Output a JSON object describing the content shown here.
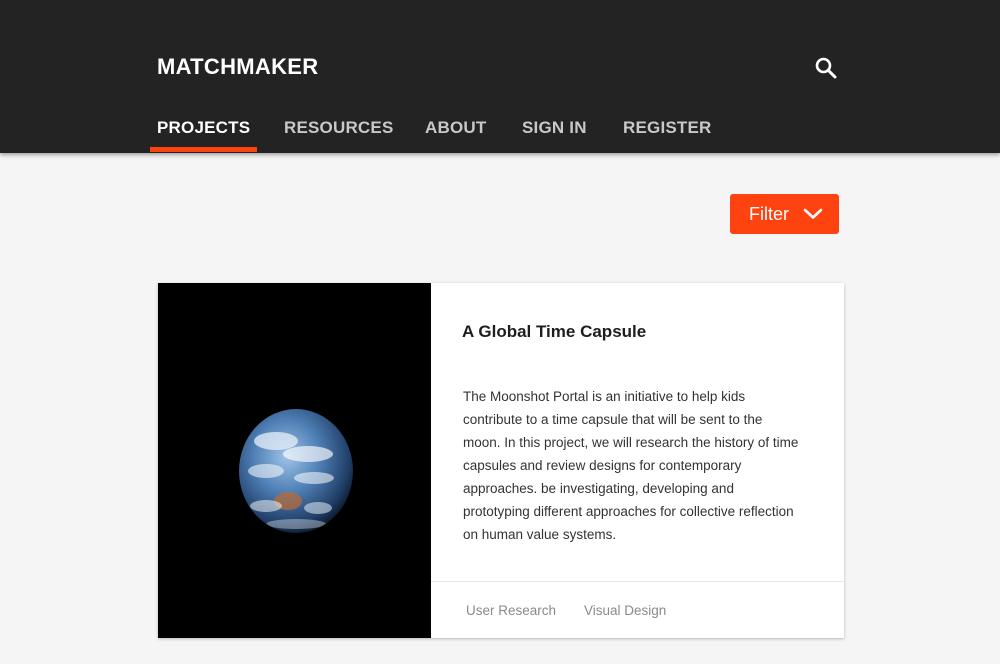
{
  "header": {
    "brand": "MATCHMAKER",
    "search_icon": "search-icon"
  },
  "nav": {
    "items": [
      {
        "label": "PROJECTS",
        "active": true
      },
      {
        "label": "RESOURCES",
        "active": false
      },
      {
        "label": "ABOUT",
        "active": false
      },
      {
        "label": "SIGN IN",
        "active": false
      },
      {
        "label": "REGISTER",
        "active": false
      }
    ]
  },
  "filter": {
    "label": "Filter",
    "icon": "chevron-down-icon"
  },
  "card": {
    "title": "A Global Time Capsule",
    "description": "The Moonshot Portal is an initiative to help kids contribute to a time capsule that will be sent to the moon. In this project, we will research the history of time capsules and review designs for contemporary approaches. be investigating, developing and prototyping different approaches for collective reflection on human value systems.",
    "image": "earth-image",
    "tags": [
      "User Research",
      "Visual Design"
    ]
  },
  "colors": {
    "header_bg": "#232323",
    "accent": "#ff4310",
    "page_bg": "#f5f5f5"
  }
}
